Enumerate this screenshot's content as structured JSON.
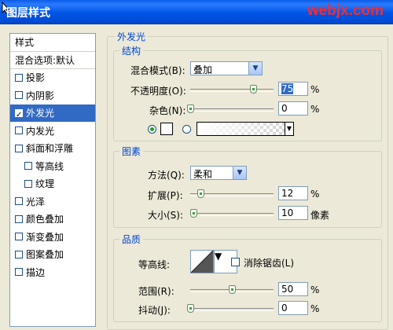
{
  "window": {
    "title": "图层样式",
    "watermark": "webjx.com"
  },
  "sidebar": {
    "items": [
      {
        "label": "样式",
        "checkbox": false,
        "checked": false
      },
      {
        "label": "混合选项:默认",
        "checkbox": false,
        "checked": false
      },
      {
        "label": "投影",
        "checkbox": true,
        "checked": false
      },
      {
        "label": "内阴影",
        "checkbox": true,
        "checked": false
      },
      {
        "label": "外发光",
        "checkbox": true,
        "checked": true,
        "selected": true
      },
      {
        "label": "内发光",
        "checkbox": true,
        "checked": false
      },
      {
        "label": "斜面和浮雕",
        "checkbox": true,
        "checked": false
      },
      {
        "label": "等高线",
        "checkbox": true,
        "checked": false,
        "indent": true
      },
      {
        "label": "纹理",
        "checkbox": true,
        "checked": false,
        "indent": true
      },
      {
        "label": "光泽",
        "checkbox": true,
        "checked": false
      },
      {
        "label": "颜色叠加",
        "checkbox": true,
        "checked": false
      },
      {
        "label": "渐变叠加",
        "checkbox": true,
        "checked": false
      },
      {
        "label": "图案叠加",
        "checkbox": true,
        "checked": false
      },
      {
        "label": "描边",
        "checkbox": true,
        "checked": false
      }
    ]
  },
  "outer_glow": {
    "section_title": "外发光",
    "structure": {
      "title": "结构",
      "blend_mode": {
        "label": "混合模式(B):",
        "value": "叠加"
      },
      "opacity": {
        "label": "不透明度(O):",
        "value": "75",
        "unit": "%",
        "fraction": 0.75
      },
      "noise": {
        "label": "杂色(N):",
        "value": "0",
        "unit": "%",
        "fraction": 0.0
      }
    },
    "elements": {
      "title": "图素",
      "method": {
        "label": "方法(Q):",
        "value": "柔和"
      },
      "spread": {
        "label": "扩展(P):",
        "value": "12",
        "unit": "%",
        "fraction": 0.12
      },
      "size": {
        "label": "大小(S):",
        "value": "10",
        "unit": "像素",
        "fraction": 0.04
      }
    },
    "quality": {
      "title": "品质",
      "contour": {
        "label": "等高线:"
      },
      "anti_alias": {
        "label": "消除锯齿(L)",
        "checked": false
      },
      "range": {
        "label": "范围(R):",
        "value": "50",
        "unit": "%",
        "fraction": 0.5
      },
      "jitter": {
        "label": "抖动(J):",
        "value": "0",
        "unit": "%",
        "fraction": 0.0
      }
    }
  },
  "colors": {
    "accent": "#316ac5",
    "group_title": "#0046d5",
    "watermark": "#ff2a2a"
  }
}
